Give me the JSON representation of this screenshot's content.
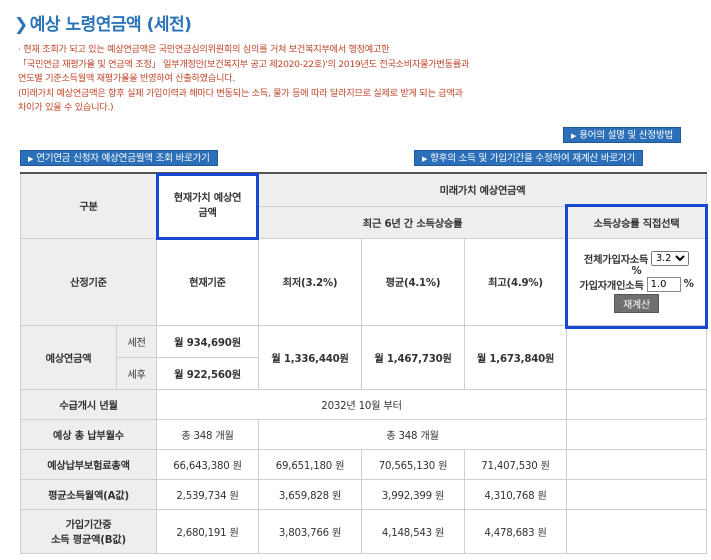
{
  "title": "예상 노령연금액 (세전)",
  "notice": [
    "· 현재 조회가 되고 있는 예상연금액은 국민연금심의위원회의 심의를 거쳐 보건복지부에서 행정예고한",
    "  「국민연금 재평가율 및 연금액 조정」 일부개정안(보건복지부 공고 제2020-22호)'의 2019년도 전국소비자물가변동률과",
    "  연도별 기준소득월액 재평가율을 반영하여 산출하였습니다.",
    "  (미래가치 예상연금액은 향후 실제 가입이력과 해마다 변동되는 소득, 물가 등에 따라 달라지므로 실제로 받게 되는 금액과",
    "  차이가 있을 수 있습니다.)"
  ],
  "buttons": {
    "terms": "용어의 설명 및 산정방법",
    "applicant": "연기연금 신청자 예상연금월액 조회 바로가기",
    "modify": "향후의 소득 및 가입기간을 수정하여 재계산 바로가기"
  },
  "table": {
    "h_category": "구분",
    "h_present": "현재가치 예상연금액",
    "h_future": "미래가치 예상연금액",
    "h_recent": "최근 6년 간 소득상승률",
    "h_direct": "소득상승률 직접선택",
    "h_basis": "산정기준",
    "h_current": "현재기준",
    "h_min": "최저(3.2%)",
    "h_avg": "평균(4.1%)",
    "h_max": "최고(4.9%)",
    "sel_label1": "전체가입자소득",
    "sel_value1": "3.2",
    "sel_unit1": "%",
    "sel_label2": "가입자개인소득",
    "sel_value2": "1.0",
    "sel_unit2": "%",
    "recalc": "재계산",
    "r_pension": "예상연금액",
    "r_pretax": "세전",
    "r_aftertax": "세후",
    "pre_current": "934,690원",
    "post_current": "922,560원",
    "won_prefix": "월",
    "fut_min": "1,336,440원",
    "fut_avg": "1,467,730원",
    "fut_max": "1,673,840원",
    "r_start": "수급개시 년월",
    "start_value": "2032년 10월 부터",
    "r_months": "예상 총 납부월수",
    "months_current": "총 348 개월",
    "months_future": "총 348 개월",
    "r_premium": "예상납부보험료총액",
    "prem": [
      "66,643,380 원",
      "69,651,180 원",
      "70,565,130 원",
      "71,407,530 원"
    ],
    "r_a": "평균소득월액(A값)",
    "a_vals": [
      "2,539,734 원",
      "3,659,828 원",
      "3,992,399 원",
      "4,310,768 원"
    ],
    "r_b1": "가입기간중",
    "r_b2": "소득 평균액(B값)",
    "b_vals": [
      "2,680,191 원",
      "3,803,766 원",
      "4,148,543 원",
      "4,478,683 원"
    ]
  }
}
